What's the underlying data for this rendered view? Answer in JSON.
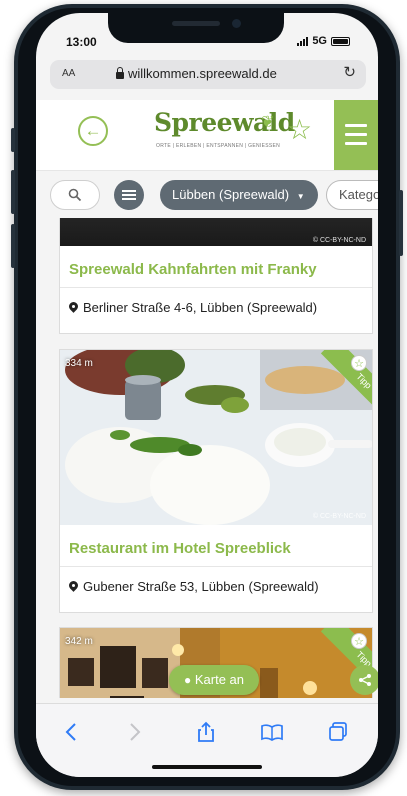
{
  "status_bar": {
    "time": "13:00",
    "network": "5G"
  },
  "browser": {
    "text_size_label": "AA",
    "url": "willkommen.spreewald.de"
  },
  "header": {
    "logo_text": "Spreewald",
    "logo_tagline": "ORTE | ERLEBEN | ENTSPANNEN | GENIESSEN"
  },
  "filters": {
    "location": "Lübben (Spreewald)",
    "category_placeholder": "Kategor"
  },
  "cards": [
    {
      "title": "Spreewald Kahnfahrten mit Franky",
      "address": "Berliner Straße 4-6, Lübben (Spreewald)",
      "credit": "© CC-BY-NC-ND"
    },
    {
      "distance": "334 m",
      "tag": "Tipp",
      "title": "Restaurant im Hotel Spreeblick",
      "address": "Gubener Straße 53, Lübben (Spreewald)",
      "credit": "© CC-BY-NC-ND"
    },
    {
      "distance": "342 m",
      "tag": "Tipp"
    }
  ],
  "map_button": "Karte an",
  "colors": {
    "brand_green": "#8cbd4e",
    "pill_dark": "#5f6a73",
    "ios_blue": "#2f7bf6"
  }
}
